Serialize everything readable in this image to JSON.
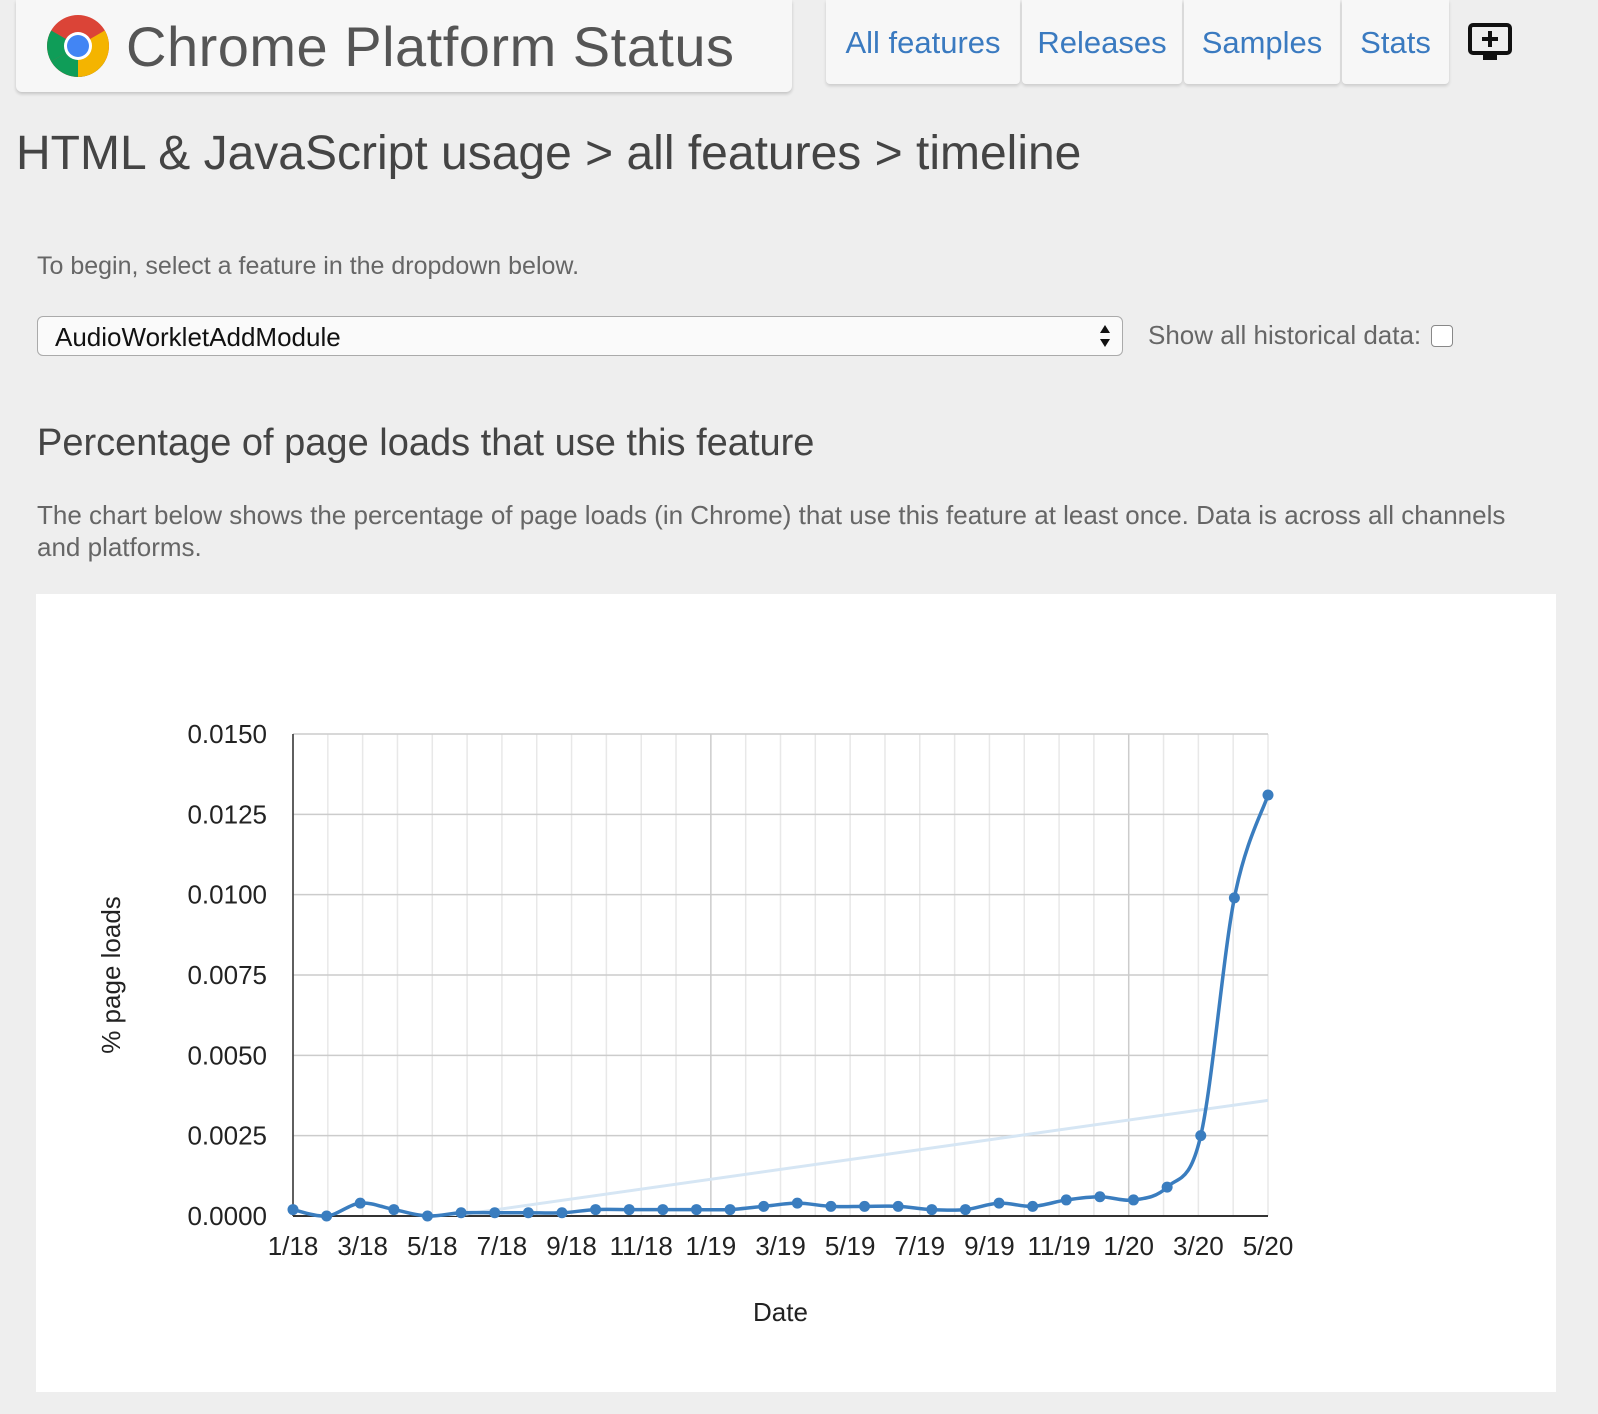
{
  "header": {
    "title": "Chrome Platform Status",
    "nav": [
      "All features",
      "Releases",
      "Samples",
      "Stats"
    ]
  },
  "breadcrumb": "HTML & JavaScript usage > all features > timeline",
  "intro": "To begin, select a feature in the dropdown below.",
  "feature_select": {
    "value": "AudioWorkletAddModule"
  },
  "historical": {
    "label": "Show all historical data:",
    "checked": false
  },
  "section_title": "Percentage of page loads that use this feature",
  "description": "The chart below shows the percentage of page loads (in Chrome) that use this feature at least once. Data is across all channels and platforms.",
  "colors": {
    "accent": "#3a7ac0",
    "series": "#3a7dbf",
    "trend": "#d6e6f4",
    "background": "#eeeeee"
  },
  "chart_data": {
    "type": "line",
    "xlabel": "Date",
    "ylabel": "% page loads",
    "x_ticks": [
      "1/18",
      "3/18",
      "5/18",
      "7/18",
      "9/18",
      "11/18",
      "1/19",
      "3/19",
      "5/19",
      "7/19",
      "9/19",
      "11/19",
      "1/20",
      "3/20",
      "5/20"
    ],
    "y_ticks": [
      "0.0000",
      "0.0025",
      "0.0050",
      "0.0075",
      "0.0100",
      "0.0125",
      "0.0150"
    ],
    "ylim": [
      0,
      0.015
    ],
    "x_months": [
      0,
      1,
      2,
      3,
      4,
      5,
      6,
      7,
      8,
      9,
      10,
      11,
      12,
      13,
      14,
      15,
      16,
      17,
      18,
      19,
      20,
      21,
      22,
      23,
      24,
      25,
      26,
      27,
      28
    ],
    "series": [
      {
        "values": [
          0.0002,
          0.0,
          0.0004,
          0.0002,
          0.0,
          0.0001,
          0.0001,
          0.0001,
          0.0001,
          0.0002,
          0.0002,
          0.0002,
          0.0002,
          0.0002,
          0.0003,
          0.0004,
          0.0003,
          0.0003,
          0.0003,
          0.0002,
          0.0002,
          0.0004,
          0.0003,
          0.0005,
          0.0006,
          0.0005,
          0.0009,
          0.0025,
          0.0099,
          0.0131
        ]
      }
    ],
    "trendline": {
      "x": [
        0,
        29
      ],
      "y": [
        -0.0007,
        0.0036
      ]
    },
    "grid": true
  }
}
